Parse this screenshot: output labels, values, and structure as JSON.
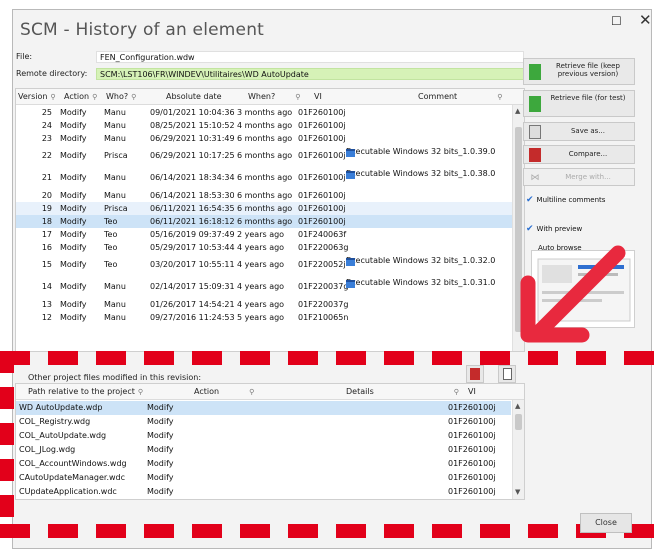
{
  "window": {
    "title": "SCM - History of an element",
    "max_glyph": "☐",
    "close_glyph": "✕"
  },
  "file": {
    "label": "File:",
    "value": "FEN_Configuration.wdw"
  },
  "remote": {
    "label": "Remote directory:",
    "value": "SCM:\\LST106\\FR\\WINDEV\\Utilitaires\\WD AutoUpdate"
  },
  "history": {
    "headers": [
      "Version",
      "Action",
      "Who?",
      "Absolute date",
      "When?",
      "VI",
      "Comment"
    ],
    "rows": [
      {
        "version": "25",
        "action": "Modify",
        "who": "Manu",
        "date": "09/01/2021 10:04:36",
        "when": "3 months ago",
        "vi": "01F260100j",
        "comment": ""
      },
      {
        "version": "24",
        "action": "Modify",
        "who": "Manu",
        "date": "08/25/2021 15:10:52",
        "when": "4 months ago",
        "vi": "01F260100j",
        "comment": ""
      },
      {
        "version": "23",
        "action": "Modify",
        "who": "Manu",
        "date": "06/29/2021 10:31:49",
        "when": "6 months ago",
        "vi": "01F260100j",
        "comment": ""
      },
      {
        "version": "22",
        "action": "Modify",
        "who": "Prisca",
        "date": "06/29/2021 10:17:25",
        "when": "6 months ago",
        "vi": "01F260100j",
        "comment": "Executable Windows 32 bits_1.0.39.0",
        "tall": true
      },
      {
        "version": "21",
        "action": "Modify",
        "who": "Manu",
        "date": "06/14/2021 18:34:34",
        "when": "6 months ago",
        "vi": "01F260100j",
        "comment": "Executable Windows 32 bits_1.0.38.0",
        "tall": true
      },
      {
        "version": "20",
        "action": "Modify",
        "who": "Manu",
        "date": "06/14/2021 18:53:30",
        "when": "6 months ago",
        "vi": "01F260100j",
        "comment": ""
      },
      {
        "version": "19",
        "action": "Modify",
        "who": "Prisca",
        "date": "06/11/2021 16:54:35",
        "when": "6 months ago",
        "vi": "01F260100j",
        "comment": "",
        "selected_light": true
      },
      {
        "version": "18",
        "action": "Modify",
        "who": "Teo",
        "date": "06/11/2021 16:18:12",
        "when": "6 months ago",
        "vi": "01F260100j",
        "comment": "",
        "selected": true
      },
      {
        "version": "17",
        "action": "Modify",
        "who": "Teo",
        "date": "05/16/2019 09:37:49",
        "when": "2 years ago",
        "vi": "01F240063f",
        "comment": ""
      },
      {
        "version": "16",
        "action": "Modify",
        "who": "Teo",
        "date": "05/29/2017 10:53:44",
        "when": "4 years ago",
        "vi": "01F220063g",
        "comment": ""
      },
      {
        "version": "15",
        "action": "Modify",
        "who": "Teo",
        "date": "03/20/2017 10:55:11",
        "when": "4 years ago",
        "vi": "01F220052j",
        "comment": "Executable Windows 32 bits_1.0.32.0",
        "tall": true
      },
      {
        "version": "14",
        "action": "Modify",
        "who": "Manu",
        "date": "02/14/2017 15:09:31",
        "when": "4 years ago",
        "vi": "01F220037g",
        "comment": "Executable Windows 32 bits_1.0.31.0",
        "tall": true
      },
      {
        "version": "13",
        "action": "Modify",
        "who": "Manu",
        "date": "01/26/2017 14:54:21",
        "when": "4 years ago",
        "vi": "01F220037g",
        "comment": ""
      },
      {
        "version": "12",
        "action": "Modify",
        "who": "Manu",
        "date": "09/27/2016 11:24:53",
        "when": "5 years ago",
        "vi": "01F210065n",
        "comment": ""
      }
    ]
  },
  "buttons": {
    "retrieve_keep": "Retrieve file (keep previous version)",
    "retrieve_test": "Retrieve file (for test)",
    "save_as": "Save as...",
    "compare": "Compare...",
    "merge": "Merge with...",
    "close": "Close"
  },
  "checks": {
    "multiline": "Multiline comments",
    "preview": "With preview",
    "autobrowse": "Auto browse"
  },
  "other": {
    "label": "Other project files modified in this revision:",
    "headers": [
      "Path relative to the project",
      "Action",
      "Details",
      "VI"
    ],
    "rows": [
      {
        "path": "WD AutoUpdate.wdp",
        "action": "Modify",
        "vi": "01F260100j",
        "selected": true
      },
      {
        "path": "COL_Registry.wdg",
        "action": "Modify",
        "vi": "01F260100j"
      },
      {
        "path": "COL_AutoUpdate.wdg",
        "action": "Modify",
        "vi": "01F260100j"
      },
      {
        "path": "COL_JLog.wdg",
        "action": "Modify",
        "vi": "01F260100j"
      },
      {
        "path": "COL_AccountWindows.wdg",
        "action": "Modify",
        "vi": "01F260100j"
      },
      {
        "path": "CAutoUpdateManager.wdc",
        "action": "Modify",
        "vi": "01F260100j"
      },
      {
        "path": "CUpdateApplication.wdc",
        "action": "Modify",
        "vi": "01F260100j"
      }
    ]
  },
  "colors": {
    "highlight_red": "#e2001a",
    "selection": "#cde3f7",
    "path_green": "#d6f2b7"
  }
}
